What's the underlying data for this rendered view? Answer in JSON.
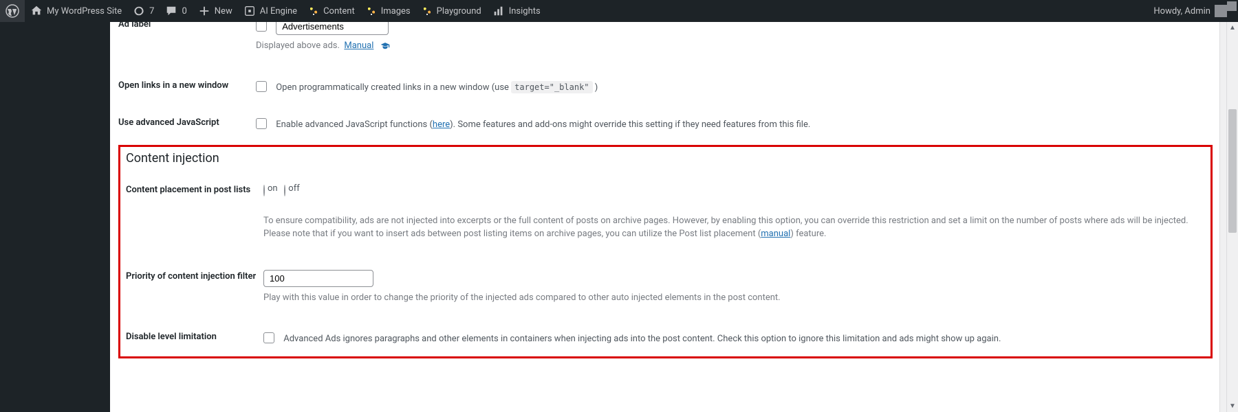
{
  "adminbar": {
    "site_name": "My WordPress Site",
    "updates_count": "7",
    "comments_count": "0",
    "new_label": "New",
    "ai_engine": "AI Engine",
    "content": "Content",
    "images": "Images",
    "playground": "Playground",
    "insights": "Insights",
    "howdy": "Howdy, Admin"
  },
  "settings": {
    "ad_label": {
      "label": "Ad label",
      "value": "Advertisements",
      "desc_before": "Displayed above ads.",
      "manual_link": "Manual"
    },
    "open_links": {
      "label": "Open links in a new window",
      "text_before": "Open programmatically created links in a new window (use ",
      "code": "target=\"_blank\"",
      "text_after": " )"
    },
    "adv_js": {
      "label": "Use advanced JavaScript",
      "text_before": "Enable advanced JavaScript functions (",
      "here_link": "here",
      "text_after": "). Some features and add-ons might override this setting if they need features from this file."
    }
  },
  "injection": {
    "heading": "Content injection",
    "placement": {
      "label": "Content placement in post lists",
      "on": "on",
      "off": "off",
      "desc_before": "To ensure compatibility, ads are not injected into excerpts or the full content of posts on archive pages. However, by enabling this option, you can override this restriction and set a limit on the number of posts where ads will be injected. Please note that if you want to insert ads between post listing items on archive pages, you can utilize the Post list placement (",
      "manual_link": "manual",
      "desc_after": ") feature."
    },
    "priority": {
      "label": "Priority of content injection filter",
      "value": "100",
      "desc": "Play with this value in order to change the priority of the injected ads compared to other auto injected elements in the post content."
    },
    "disable_level": {
      "label": "Disable level limitation",
      "desc": "Advanced Ads ignores paragraphs and other elements in containers when injecting ads into the post content. Check this option to ignore this limitation and ads might show up again."
    }
  }
}
